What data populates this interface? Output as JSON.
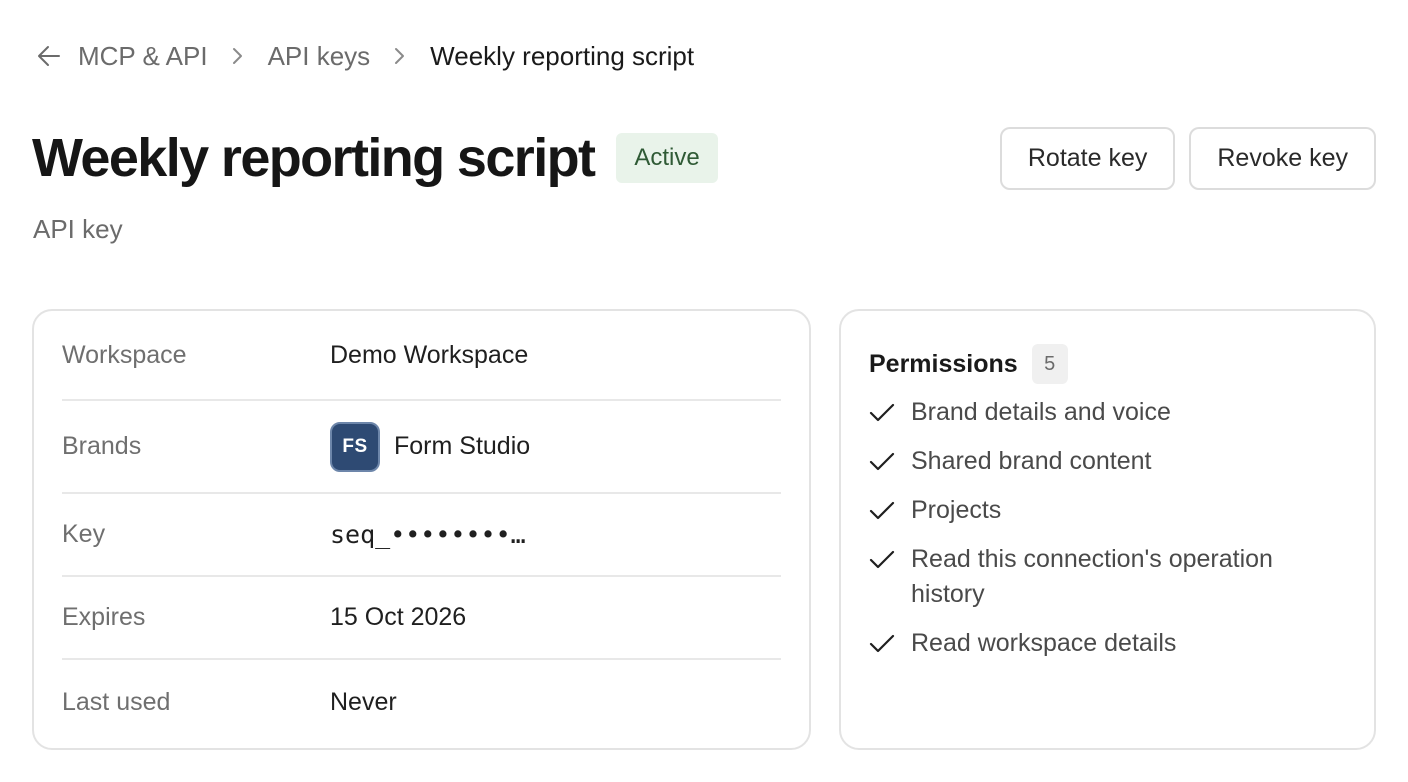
{
  "breadcrumb": {
    "items": [
      "MCP & API",
      "API keys"
    ],
    "current": "Weekly reporting script"
  },
  "header": {
    "title": "Weekly reporting script",
    "status": "Active",
    "subtitle": "API key",
    "rotate_label": "Rotate key",
    "revoke_label": "Revoke key"
  },
  "details": {
    "workspace": {
      "label": "Workspace",
      "value": "Demo Workspace"
    },
    "brands": {
      "label": "Brands",
      "avatar": "FS",
      "value": "Form Studio"
    },
    "key": {
      "label": "Key",
      "value": "seq_••••••••…"
    },
    "expires": {
      "label": "Expires",
      "value": "15 Oct 2026"
    },
    "last_used": {
      "label": "Last used",
      "value": "Never"
    }
  },
  "permissions": {
    "title": "Permissions",
    "count": "5",
    "items": [
      "Brand details and voice",
      "Shared brand content",
      "Projects",
      "Read this connection's operation history",
      "Read workspace details"
    ]
  },
  "colors": {
    "status_bg": "#e9f3ea",
    "status_text": "#2f5a35",
    "avatar_bg": "#2e4a73"
  },
  "icons": [
    "arrow-left-icon",
    "chevron-right-icon",
    "check-icon"
  ]
}
